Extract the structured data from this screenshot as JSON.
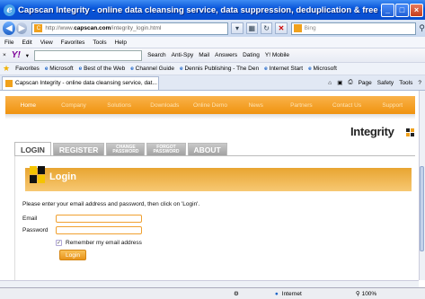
{
  "window": {
    "title": "Capscan Integrity - online data cleansing service, data suppression, deduplication & free data - Windows Inter...",
    "minimize": "_",
    "maximize": "□",
    "close": "×"
  },
  "address_bar": {
    "url_prefix": "http://www.",
    "url_domain": "capscan.com",
    "url_path": "/integrity_login.html",
    "search_placeholder": "Bing"
  },
  "menu": [
    "File",
    "Edit",
    "View",
    "Favorites",
    "Tools",
    "Help"
  ],
  "yahoo_toolbar": {
    "search_label": "Search",
    "items": [
      "Anti-Spy",
      "Mail",
      "Answers",
      "Dating",
      "Y! Mobile"
    ]
  },
  "favorites_bar": {
    "label": "Favorites",
    "items": [
      "Microsoft",
      "Best of the Web",
      "Channel Guide",
      "Dennis Publishing - The Den",
      "Internet Start",
      "Microsoft"
    ]
  },
  "tab": {
    "title": "Capscan Integrity - online data cleansing service, dat..."
  },
  "commands": [
    "Page",
    "Safety",
    "Tools"
  ],
  "site_nav": [
    "Home",
    "Company",
    "Solutions",
    "Downloads",
    "Online Demo",
    "News",
    "Partners",
    "Contact Us",
    "Support"
  ],
  "logo": {
    "text": "Integrity"
  },
  "login_tabs": {
    "login": "LOGIN",
    "register": "REGISTER",
    "change_1": "CHANGE",
    "change_2": "PASSWORD",
    "forgot_1": "FORGOT",
    "forgot_2": "PASSWORD",
    "about": "ABOUT"
  },
  "login": {
    "heading": "Login",
    "instructions": "Please enter your email address and password, then click on 'Login'.",
    "email_label": "Email",
    "password_label": "Password",
    "remember_label": "Remember my email address",
    "button": "Login"
  },
  "status_bar": {
    "zone": "Internet",
    "zoom": "100%"
  },
  "colors": {
    "accent_orange": "#f0930e",
    "titlebar_blue": "#0553d8"
  }
}
